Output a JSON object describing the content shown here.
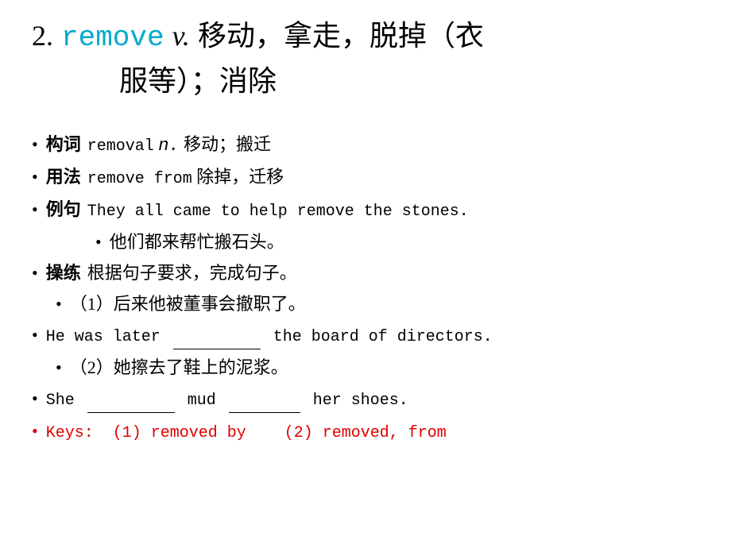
{
  "entry": {
    "number": "2.",
    "word": "remove",
    "pos": "v.",
    "definition1": "移动，拿走，脱掉（衣",
    "definition2": "服等）；消除"
  },
  "bullets": [
    {
      "id": "goucí",
      "label": "构词",
      "content_mono": "removal",
      "content_pos": "n.",
      "content_zh": "移动；搬迁"
    },
    {
      "id": "yongfa",
      "label": "用法",
      "content_mono": "remove from",
      "content_zh": "除掉，迁移"
    },
    {
      "id": "liju",
      "label": "例句",
      "content_mono": "They all came to help remove the stones."
    },
    {
      "id": "liju-zh",
      "label": "",
      "content_zh": "他们都来帮忙搬石头。",
      "indent": true
    },
    {
      "id": "caolian",
      "label": "操练",
      "content_zh": "根据句子要求，完成句子。"
    },
    {
      "id": "ex1-zh",
      "label": "",
      "content_zh": "（1）后来他被董事会撤职了。",
      "indent": true
    },
    {
      "id": "ex1-en",
      "label": "",
      "content_en_pre": "He was later",
      "blank1": true,
      "content_en_post": "the board of directors."
    },
    {
      "id": "ex2-zh",
      "label": "",
      "content_zh": "（2）她擦去了鞋上的泥浆。",
      "indent": true
    },
    {
      "id": "ex2-en",
      "label": "",
      "content_en_she": true
    },
    {
      "id": "keys",
      "label": "",
      "keys": true,
      "content": "Keys:  (1) removed by    (2) removed, from"
    }
  ],
  "keys": {
    "prefix": "Keys:",
    "answer1_label": "(1)",
    "answer1_value": "removed by",
    "answer2_label": "(2)",
    "answer2_value": "removed, from"
  }
}
